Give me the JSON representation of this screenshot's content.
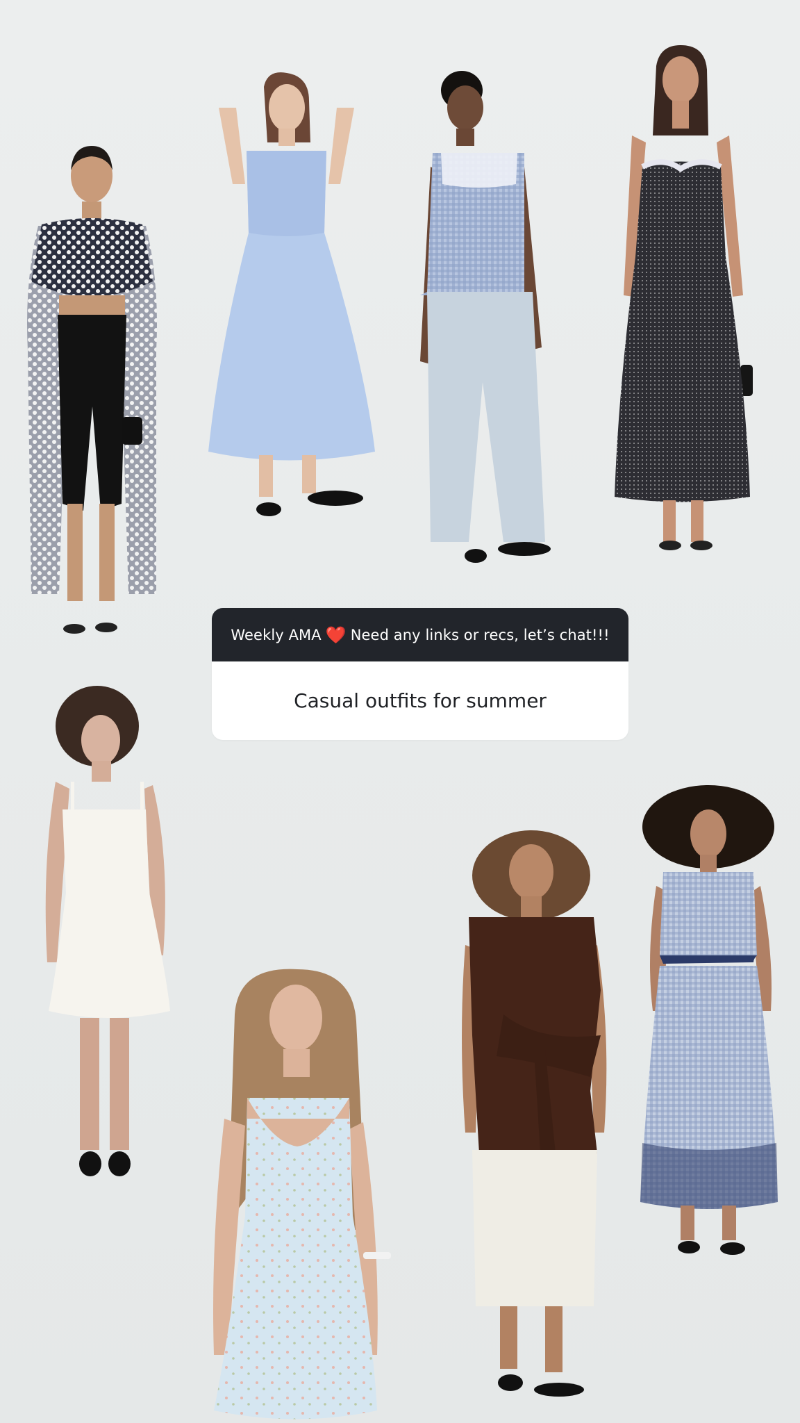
{
  "question_box": {
    "prompt_before": "Weekly AMA",
    "heart": "❤️",
    "prompt_after": "Need any links or recs, let’s chat!!!",
    "answer": "Casual outfits for summer",
    "header_color": "#22252b",
    "heart_color": "#e0191e"
  },
  "outfits": [
    {
      "name": "polka-dot-cape-with-black-capri-leggings",
      "icon": "fashion-model-image"
    },
    {
      "name": "light-blue-midi-dress",
      "icon": "fashion-model-image"
    },
    {
      "name": "gingham-lace-top-with-light-jeans",
      "icon": "fashion-model-image"
    },
    {
      "name": "black-polka-dot-maxi-dress",
      "icon": "fashion-model-image"
    },
    {
      "name": "white-tie-strap-mini-dress",
      "icon": "fashion-model-image"
    },
    {
      "name": "pale-blue-floral-mini-dress",
      "icon": "fashion-model-image"
    },
    {
      "name": "brown-tie-waist-shirt-with-white-shorts",
      "icon": "fashion-model-image"
    },
    {
      "name": "blue-gingham-set-with-embroidered-skirt",
      "icon": "fashion-model-image"
    }
  ]
}
